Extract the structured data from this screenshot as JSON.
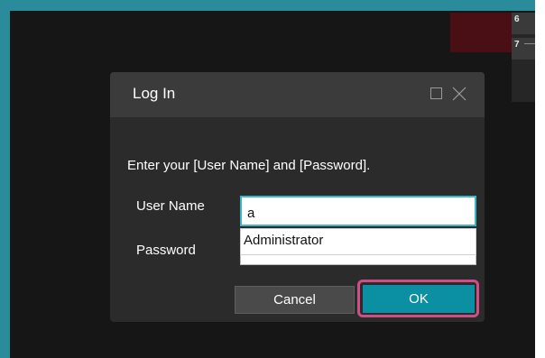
{
  "background": {
    "accent_color": "#2a8b9a",
    "cells": [
      "6",
      "7"
    ]
  },
  "dialog": {
    "title": "Log In",
    "prompt": "Enter your [User Name] and [Password].",
    "user_label": "User Name",
    "user_value": "a",
    "autocomplete_options": [
      "Administrator"
    ],
    "password_label": "Password",
    "password_value": "",
    "cancel_label": "Cancel",
    "ok_label": "OK",
    "highlight_color": "#cf4e86",
    "ok_color": "#0b8fa3",
    "focus_color": "#3ab6c6"
  }
}
